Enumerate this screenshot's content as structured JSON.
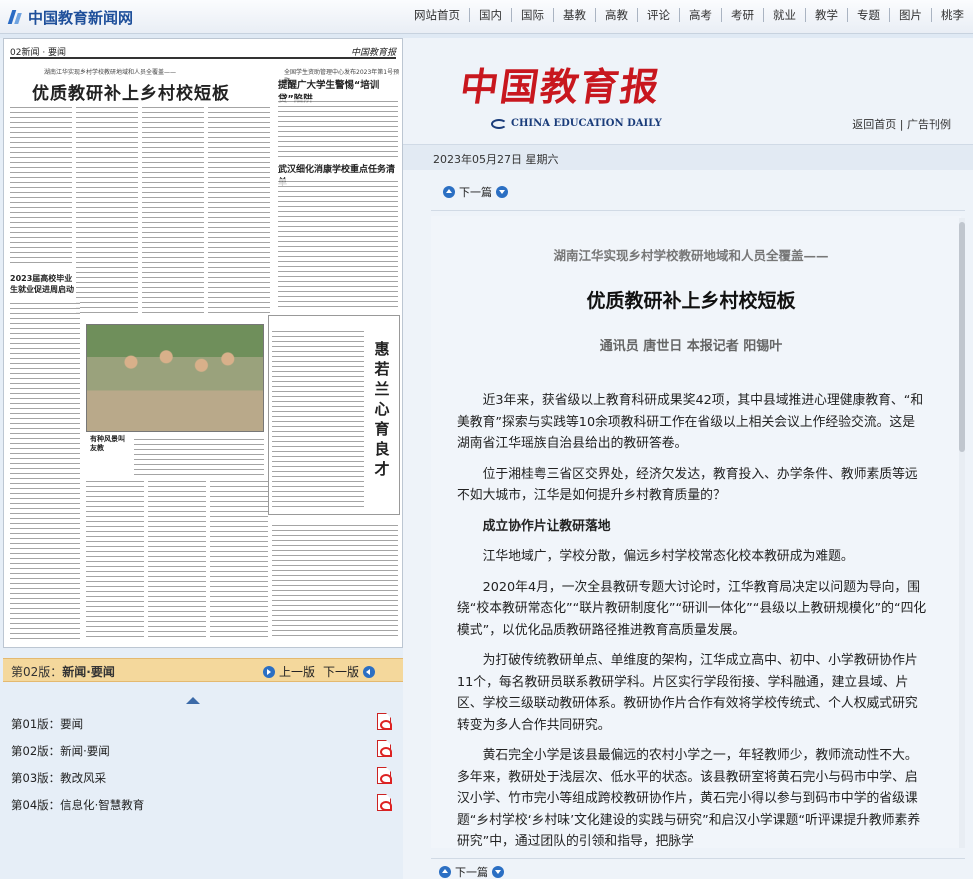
{
  "site": {
    "logo_text": "中国教育新闻网"
  },
  "topnav": [
    "网站首页",
    "国内",
    "国际",
    "基教",
    "高教",
    "评论",
    "高考",
    "考研",
    "就业",
    "教学",
    "专题",
    "图片",
    "桃李"
  ],
  "newspaper_page": {
    "page_label": "02新闻 · 要闻",
    "brand": "中国教育报",
    "kicker": "湖南江华实现乡村学校教研地域和人员全覆盖——",
    "headline": "优质教研补上乡村校短板",
    "side_kicker": "全国学生资助管理中心发布2023年第1号预警",
    "side_head": "提醒广大学生警惕“培训贷”陷阱",
    "side_head2": "武汉细化消康学校重点任务清单",
    "small_head": "2023届高校毕业生就业促进周启动",
    "photo_caption": "有种风景叫友教",
    "vertical_title": "惠若兰心育良才"
  },
  "edition_bar": {
    "current_prefix": "第02版：",
    "current_name": "新闻·要闻",
    "prev_label": "上一版",
    "next_label": "下一版"
  },
  "editions": [
    {
      "label": "第01版：要闻"
    },
    {
      "label": "第02版：新闻·要闻"
    },
    {
      "label": "第03版：教改风采"
    },
    {
      "label": "第04版：信息化·智慧教育"
    }
  ],
  "masthead": {
    "title": "中国教育报",
    "english": "CHINA EDUCATION DAILY",
    "link_home": "返回首页",
    "link_sep": " | ",
    "link_ads": "广告刊例"
  },
  "date": "2023年05月27日 星期六",
  "nav_next_label": "下一篇",
  "article": {
    "kicker": "湖南江华实现乡村学校教研地域和人员全覆盖——",
    "title": "优质教研补上乡村校短板",
    "byline": "通讯员 唐世日 本报记者 阳锡叶",
    "paragraphs": [
      "近3年来，获省级以上教育科研成果奖42项，其中县域推进心理健康教育、“和美教育”探索与实践等10余项教科研工作在省级以上相关会议上作经验交流。这是湖南省江华瑶族自治县给出的教研答卷。",
      "位于湘桂粤三省区交界处，经济欠发达，教育投入、办学条件、教师素质等远不如大城市，江华是如何提升乡村教育质量的？",
      "成立协作片让教研落地",
      "江华地域广，学校分散，偏远乡村学校常态化校本教研成为难题。",
      "2020年4月，一次全县教研专题大讨论时，江华教育局决定以问题为导向，围绕“校本教研常态化”“联片教研制度化”“研训一体化”“县级以上教研规模化”的“四化模式”，以优化品质教研路径推进教育高质量发展。",
      "为打破传统教研单点、单维度的架构，江华成立高中、初中、小学教研协作片11个，每名教研员联系教研学科。片区实行学段衔接、学科融通，建立县域、片区、学校三级联动教研体系。教研协作片合作有效将学校传统式、个人权威式研究转变为多人合作共同研究。",
      "黄石完全小学是该县最偏远的农村小学之一，年轻教师少，教师流动性不大。多年来，教研处于浅层次、低水平的状态。该县教研室将黄石完小与码市中学、启汉小学、竹市完小等组成跨校教研协作片，黄石完小得以参与到码市中学的省级课题“乡村学校‘乡村味’文化建设的实践与研究”和启汉小学课题“听评课提升教师素养研究”中，通过团队的引领和指导，把脉学"
    ]
  }
}
